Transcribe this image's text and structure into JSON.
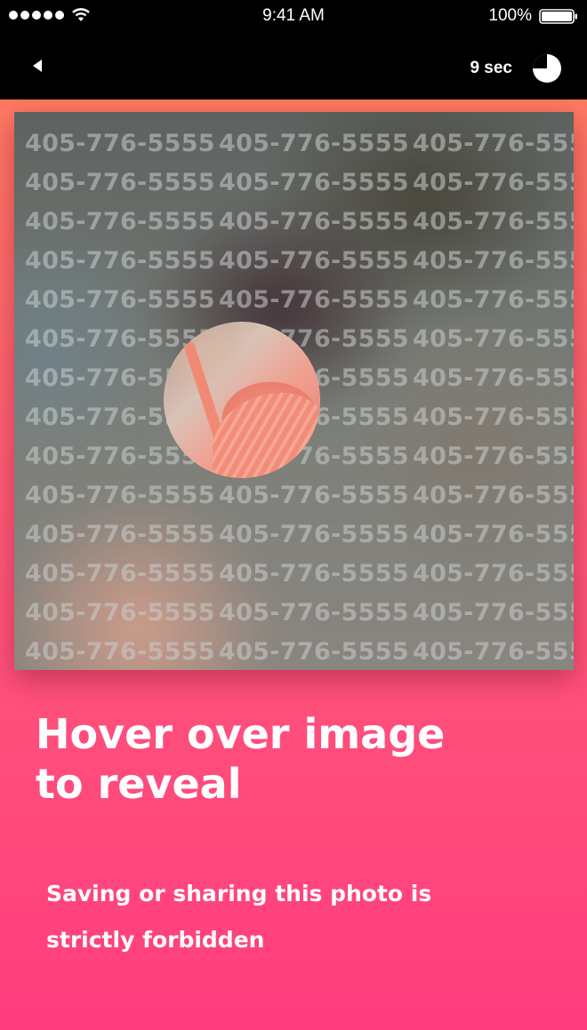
{
  "status_bar": {
    "time": "9:41 AM",
    "battery": "100%",
    "signal_icon": "signal-dots-icon",
    "wifi_icon": "wifi-icon",
    "battery_icon": "battery-icon"
  },
  "nav_bar": {
    "back_icon": "back-arrow-icon",
    "timer": "9 sec",
    "timer_icon": "pie-timer-icon"
  },
  "photo": {
    "watermark_text": "405-776-5555",
    "watermark_rows": 14,
    "watermark_cols": 3
  },
  "hint": {
    "title_line1": "Hover over image",
    "title_line2": "to reveal"
  },
  "warning": {
    "line1": "Saving or sharing this photo is",
    "line2": "strictly forbidden"
  },
  "colors": {
    "top_gradient": "#ff7a62",
    "bottom_gradient": "#ff3d7f",
    "bar_bg": "#000000",
    "text": "#ffffff"
  }
}
